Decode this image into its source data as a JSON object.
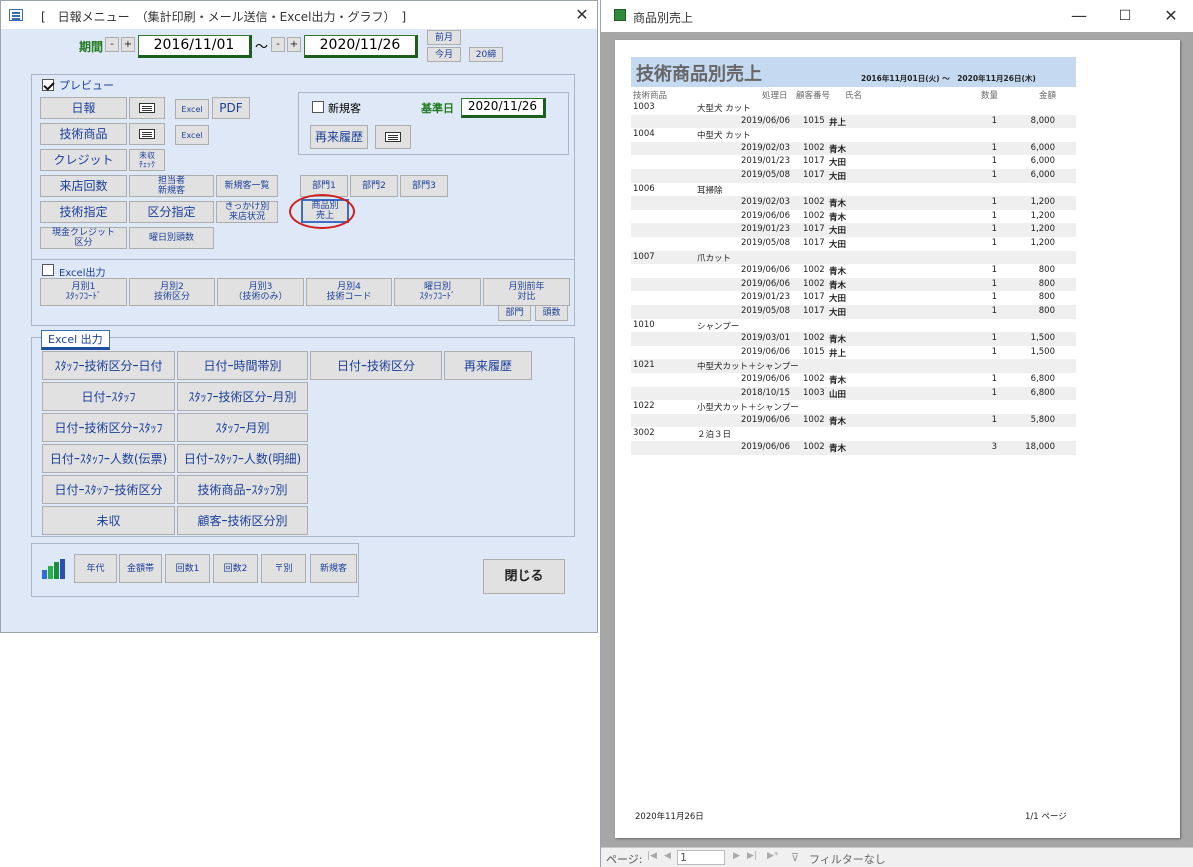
{
  "menu_window": {
    "title": "[　日報メニュー　（集計印刷・メール送信・Excel出力・グラフ）　]",
    "close_symbol": "✕",
    "period_label": "期間",
    "minus": "-",
    "plus": "+",
    "tilde": "～",
    "date_from": "2016/11/01",
    "date_to": "2020/11/26",
    "prev_month": "前月",
    "this_month": "今月",
    "close_date": "20締",
    "preview_label": "プレビュー",
    "preview_buttons": {
      "nippo": "日報",
      "gijutsu_shohin": "技術商品",
      "credit": "クレジット",
      "mishu_check": "未収\nﾁｪｯｸ",
      "raiten_kaisu": "来店回数",
      "tantosha_shinki": "担当者\n新規客",
      "shinkikyaku_ichiran": "新規客一覧",
      "gijutsu_shitei": "技術指定",
      "kubun_shitei": "区分指定",
      "kikkake_raiten": "きっかけ別\n来店状況",
      "shohin_uriage": "商品別\n売上",
      "genkin_credit_kubun": "現金クレジット\n区分",
      "youbi_ninzu": "曜日別頭数",
      "excel1": "Excel",
      "excel2": "Excel",
      "pdf": "PDF",
      "bumon1": "部門1",
      "bumon2": "部門2",
      "bumon3": "部門3"
    },
    "shinkikyaku_check": "新規客",
    "kijunbi_label": "基準日",
    "kijunbi_date": "2020/11/26",
    "raiten_rireki": "再来履歴",
    "excel_output_label": "Excel出力",
    "excel_monthly": [
      "月別1\nｽﾀｯﾌｺｰﾄﾞ",
      "月別2\n技術区分",
      "月別3\n（技術のみ）",
      "月別4\n技術コード",
      "曜日別\nｽﾀｯﾌｺｰﾄﾞ",
      "月別前年\n対比"
    ],
    "bumon": "部門",
    "tosu": "頭数",
    "excel_section_title": "Excel 出力",
    "excel_section_buttons": [
      "ｽﾀｯﾌｰ技術区分ｰ日付",
      "日付ｰ時間帯別",
      "日付ｰ技術区分",
      "再来履歴",
      "日付ｰｽﾀｯﾌ",
      "ｽﾀｯﾌｰ技術区分ｰ月別",
      "日付ｰ技術区分ｰｽﾀｯﾌ",
      "ｽﾀｯﾌｰ月別",
      "日付ｰｽﾀｯﾌｰ人数(伝票)",
      "日付ｰｽﾀｯﾌｰ人数(明細)",
      "日付ｰｽﾀｯﾌｰ技術区分",
      "技術商品ｰｽﾀｯﾌ別",
      "未収",
      "顧客ｰ技術区分別"
    ],
    "graph_buttons": [
      "年代",
      "金額帯",
      "回数1",
      "回数2",
      "〒別",
      "新規客"
    ],
    "close_button": "閉じる"
  },
  "report_window": {
    "title": "商品別売上",
    "minimize": "—",
    "maximize": "☐",
    "close": "✕",
    "report_title": "技術商品別売上",
    "period_text": "2016年11月01日(火)  ～　2020年11月26日(木)",
    "headers": [
      "技術商品",
      "処理日",
      "顧客番号",
      "氏名",
      "数量",
      "金額"
    ],
    "groups": [
      {
        "code": "1003",
        "name": "大型犬 カット",
        "rows": [
          {
            "date": "2019/06/06",
            "cust": "1015",
            "name": "井上",
            "qty": "1",
            "amount": "8,000"
          }
        ]
      },
      {
        "code": "1004",
        "name": "中型犬 カット",
        "rows": [
          {
            "date": "2019/02/03",
            "cust": "1002",
            "name": "青木",
            "qty": "1",
            "amount": "6,000"
          },
          {
            "date": "2019/01/23",
            "cust": "1017",
            "name": "大田",
            "qty": "1",
            "amount": "6,000"
          },
          {
            "date": "2019/05/08",
            "cust": "1017",
            "name": "大田",
            "qty": "1",
            "amount": "6,000"
          }
        ]
      },
      {
        "code": "1006",
        "name": "耳掃除",
        "rows": [
          {
            "date": "2019/02/03",
            "cust": "1002",
            "name": "青木",
            "qty": "1",
            "amount": "1,200"
          },
          {
            "date": "2019/06/06",
            "cust": "1002",
            "name": "青木",
            "qty": "1",
            "amount": "1,200"
          },
          {
            "date": "2019/01/23",
            "cust": "1017",
            "name": "大田",
            "qty": "1",
            "amount": "1,200"
          },
          {
            "date": "2019/05/08",
            "cust": "1017",
            "name": "大田",
            "qty": "1",
            "amount": "1,200"
          }
        ]
      },
      {
        "code": "1007",
        "name": "爪カット",
        "rows": [
          {
            "date": "2019/06/06",
            "cust": "1002",
            "name": "青木",
            "qty": "1",
            "amount": "800"
          },
          {
            "date": "2019/06/06",
            "cust": "1002",
            "name": "青木",
            "qty": "1",
            "amount": "800"
          },
          {
            "date": "2019/01/23",
            "cust": "1017",
            "name": "大田",
            "qty": "1",
            "amount": "800"
          },
          {
            "date": "2019/05/08",
            "cust": "1017",
            "name": "大田",
            "qty": "1",
            "amount": "800"
          }
        ]
      },
      {
        "code": "1010",
        "name": "シャンプー",
        "rows": [
          {
            "date": "2019/03/01",
            "cust": "1002",
            "name": "青木",
            "qty": "1",
            "amount": "1,500"
          },
          {
            "date": "2019/06/06",
            "cust": "1015",
            "name": "井上",
            "qty": "1",
            "amount": "1,500"
          }
        ]
      },
      {
        "code": "1021",
        "name": "中型犬カット＋シャンプー",
        "rows": [
          {
            "date": "2019/06/06",
            "cust": "1002",
            "name": "青木",
            "qty": "1",
            "amount": "6,800"
          },
          {
            "date": "2018/10/15",
            "cust": "1003",
            "name": "山田",
            "qty": "1",
            "amount": "6,800"
          }
        ]
      },
      {
        "code": "1022",
        "name": "小型犬カット＋シャンプー",
        "rows": [
          {
            "date": "2019/06/06",
            "cust": "1002",
            "name": "青木",
            "qty": "1",
            "amount": "5,800"
          }
        ]
      },
      {
        "code": "3002",
        "name": "２泊３日",
        "rows": [
          {
            "date": "2019/06/06",
            "cust": "1002",
            "name": "青木",
            "qty": "3",
            "amount": "18,000"
          }
        ]
      }
    ],
    "footer_date": "2020年11月26日",
    "footer_page": "1/1 ページ",
    "status_page_label": "ページ:",
    "status_page_value": "1",
    "status_filter": "フィルターなし"
  }
}
